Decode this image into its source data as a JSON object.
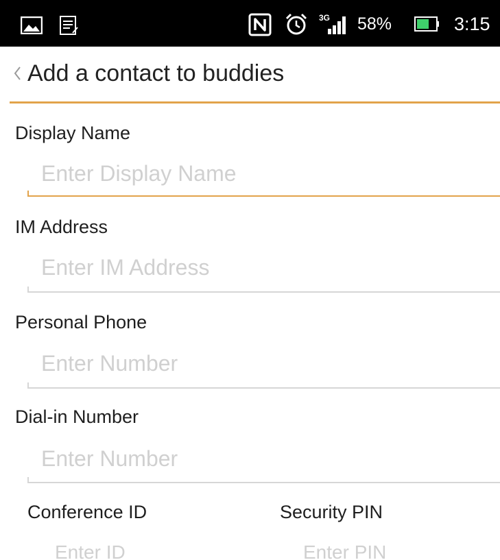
{
  "status_bar": {
    "battery_percent": "58%",
    "time": "3:15",
    "network_type": "3G",
    "icons": [
      "gallery-icon",
      "notes-icon",
      "nfc-icon",
      "alarm-icon",
      "signal-icon",
      "battery-icon"
    ]
  },
  "header": {
    "title": "Add a contact to buddies",
    "accent_color": "#e2a34a"
  },
  "form": {
    "display_name": {
      "label": "Display Name",
      "placeholder": "Enter Display Name",
      "value": ""
    },
    "im_address": {
      "label": "IM Address",
      "placeholder": "Enter IM Address",
      "value": ""
    },
    "personal_phone": {
      "label": "Personal Phone",
      "placeholder": "Enter Number",
      "value": ""
    },
    "dial_in_number": {
      "label": "Dial-in Number",
      "placeholder": "Enter Number",
      "value": ""
    },
    "conference_id": {
      "label": "Conference ID",
      "placeholder": "Enter ID",
      "value": ""
    },
    "security_pin": {
      "label": "Security PIN",
      "placeholder": "Enter PIN",
      "value": ""
    }
  }
}
